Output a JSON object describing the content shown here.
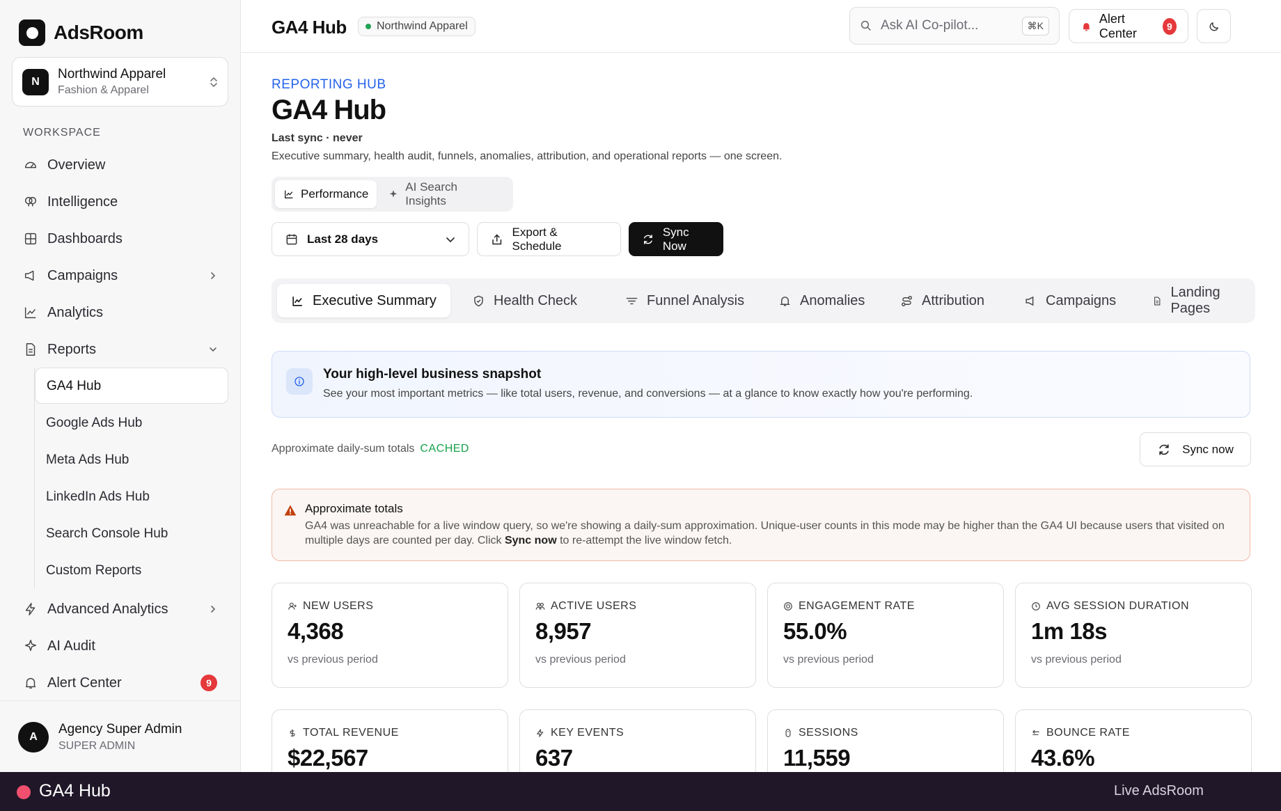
{
  "brand": {
    "name": "AdsRoom"
  },
  "account": {
    "initial": "N",
    "name": "Northwind Apparel",
    "industry": "Fashion & Apparel"
  },
  "sidebar": {
    "section_label": "WORKSPACE",
    "items": [
      {
        "label": "Overview"
      },
      {
        "label": "Intelligence"
      },
      {
        "label": "Dashboards"
      },
      {
        "label": "Campaigns"
      },
      {
        "label": "Analytics"
      },
      {
        "label": "Reports"
      }
    ],
    "report_items": [
      {
        "label": "GA4 Hub"
      },
      {
        "label": "Google Ads Hub"
      },
      {
        "label": "Meta Ads Hub"
      },
      {
        "label": "LinkedIn Ads Hub"
      },
      {
        "label": "Search Console Hub"
      },
      {
        "label": "Custom Reports"
      }
    ],
    "lower_items": [
      {
        "label": "Advanced Analytics"
      },
      {
        "label": "AI Audit"
      },
      {
        "label": "Alert Center",
        "badge": "9"
      }
    ]
  },
  "user": {
    "initial": "A",
    "name": "Agency Super Admin",
    "role": "SUPER ADMIN"
  },
  "topbar": {
    "title": "GA4 Hub",
    "account_pill": "Northwind Apparel",
    "search_placeholder": "Ask AI Co-pilot...",
    "search_shortcut": "⌘K",
    "alert_label": "Alert Center",
    "alert_count": "9"
  },
  "page": {
    "eyebrow": "REPORTING HUB",
    "title": "GA4 Hub",
    "last_sync": "Last sync · never",
    "description": "Executive summary, health audit, funnels, anomalies, attribution, and operational reports — one screen.",
    "modes": [
      {
        "label": "Performance"
      },
      {
        "label": "AI Search Insights"
      }
    ],
    "date_range": "Last 28 days",
    "export_label": "Export & Schedule",
    "sync_label": "Sync Now"
  },
  "tabs": [
    {
      "label": "Executive Summary"
    },
    {
      "label": "Health Check"
    },
    {
      "label": "Funnel Analysis"
    },
    {
      "label": "Anomalies"
    },
    {
      "label": "Attribution"
    },
    {
      "label": "Campaigns"
    },
    {
      "label": "Landing Pages"
    }
  ],
  "info": {
    "title": "Your high-level business snapshot",
    "text": "See your most important metrics — like total users, revenue, and conversions — at a glance to know exactly how you're performing."
  },
  "status": {
    "approx_text": "Approximate daily-sum totals",
    "cache_state": "CACHED",
    "sync_small": "Sync now"
  },
  "warning": {
    "title": "Approximate totals",
    "text_before": "GA4 was unreachable for a live window query, so we're showing a daily-sum approximation. Unique-user counts in this mode may be higher than the GA4 UI because users that visited on multiple days are counted per day. Click ",
    "text_bold": "Sync now",
    "text_after": " to re-attempt the live window fetch."
  },
  "metrics": [
    {
      "label": "NEW USERS",
      "value": "4,368",
      "sub": "vs previous period",
      "icon": "user-plus-icon"
    },
    {
      "label": "ACTIVE USERS",
      "value": "8,957",
      "sub": "vs previous period",
      "icon": "users-icon"
    },
    {
      "label": "ENGAGEMENT RATE",
      "value": "55.0%",
      "sub": "vs previous period",
      "icon": "target-icon"
    },
    {
      "label": "AVG SESSION DURATION",
      "value": "1m 18s",
      "sub": "vs previous period",
      "icon": "clock-icon"
    },
    {
      "label": "TOTAL REVENUE",
      "value": "$22,567",
      "icon": "dollar-icon"
    },
    {
      "label": "KEY EVENTS",
      "value": "637",
      "icon": "bolt-icon"
    },
    {
      "label": "SESSIONS",
      "value": "11,559",
      "icon": "mouse-icon"
    },
    {
      "label": "BOUNCE RATE",
      "value": "43.6%",
      "icon": "return-icon"
    }
  ],
  "bottom_bar": {
    "title": "GA4 Hub",
    "right": "Live AdsRoom"
  },
  "colors": {
    "accent_blue": "#2563eb",
    "cached_green": "#16a34a",
    "badge_red": "#e5383b",
    "warning_border": "#f2b9a8"
  }
}
